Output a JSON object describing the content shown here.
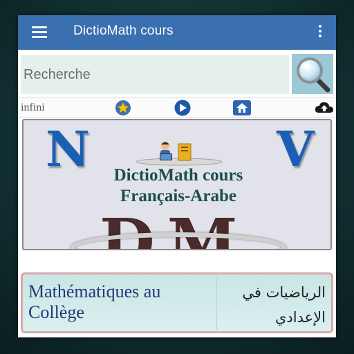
{
  "appbar": {
    "title": "DictioMath cours",
    "menu_icon": "hamburger-menu-icon",
    "overflow_icon": "more-vertical-icon",
    "color": "#3a6fb0"
  },
  "search": {
    "placeholder": "Recherche",
    "value": "",
    "button_icon": "magnifier-icon"
  },
  "toolbar": {
    "infini_label": "infini",
    "icons": [
      "star-icon",
      "play-icon",
      "home-icon",
      "cloud-upload-icon"
    ]
  },
  "banner": {
    "letter_left": "N",
    "letter_right": "V",
    "title_line1": "DictioMath cours",
    "title_line2": "Français-Arabe",
    "logo_text": "DM",
    "accent": "#1a5fb4"
  },
  "course": {
    "label_fr": "Mathématiques au Collège",
    "label_ar": "الرياضيات في الإعدادي"
  }
}
